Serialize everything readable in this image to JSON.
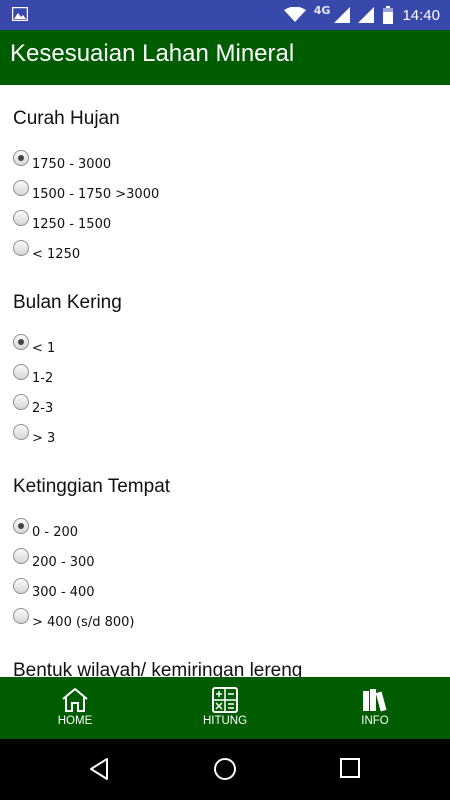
{
  "status_bar": {
    "network": "4G",
    "time": "14:40"
  },
  "app_bar": {
    "title": "Kesesuaian Lahan Mineral"
  },
  "sections": [
    {
      "title": "Curah Hujan",
      "options": [
        {
          "label": "1750 - 3000",
          "checked": true
        },
        {
          "label": "1500 - 1750 >3000",
          "checked": false
        },
        {
          "label": "1250 - 1500",
          "checked": false
        },
        {
          "label": "< 1250",
          "checked": false
        }
      ]
    },
    {
      "title": "Bulan Kering",
      "options": [
        {
          "label": "< 1",
          "checked": true
        },
        {
          "label": "1-2",
          "checked": false
        },
        {
          "label": "2-3",
          "checked": false
        },
        {
          "label": "> 3",
          "checked": false
        }
      ]
    },
    {
      "title": "Ketinggian Tempat",
      "options": [
        {
          "label": "0 - 200",
          "checked": true
        },
        {
          "label": "200 - 300",
          "checked": false
        },
        {
          "label": "300 - 400",
          "checked": false
        },
        {
          "label": "> 400 (s/d 800)",
          "checked": false
        }
      ]
    },
    {
      "title": "Bentuk wilayah/ kemiringan lereng"
    }
  ],
  "bottom_nav": {
    "home": {
      "label": "HOME",
      "icon": "home-icon"
    },
    "hitung": {
      "label": "HITUNG",
      "icon": "calculator-icon"
    },
    "info": {
      "label": "INFO",
      "icon": "books-icon"
    }
  },
  "colors": {
    "status_bar": "#3949ab",
    "app_bar": "#005c00",
    "bottom_nav": "#005c00"
  }
}
